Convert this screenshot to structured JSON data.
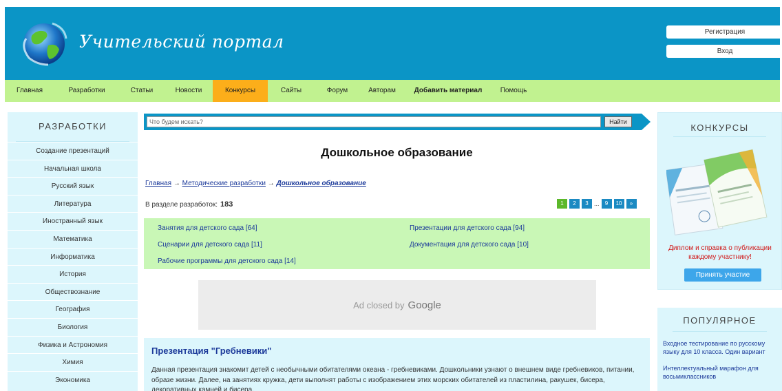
{
  "header": {
    "logo_text": "Учительский портал",
    "register": "Регистрация",
    "login": "Вход"
  },
  "nav": {
    "items": [
      {
        "label": "Главная",
        "w": 72
      },
      {
        "label": "Разработки",
        "w": 94
      },
      {
        "label": "Статьи",
        "w": 66
      },
      {
        "label": "Новости",
        "w": 70
      },
      {
        "label": "Конкурсы",
        "w": 80,
        "active": true
      },
      {
        "label": "Сайты",
        "w": 68
      },
      {
        "label": "Форум",
        "w": 66
      },
      {
        "label": "Авторам",
        "w": 64
      },
      {
        "label": "Добавить материал",
        "w": 128,
        "bold": true
      },
      {
        "label": "Помощь",
        "w": 62
      }
    ]
  },
  "left_panel": {
    "title": "РАЗРАБОТКИ",
    "items": [
      "Создание презентаций",
      "Начальная школа",
      "Русский язык",
      "Литература",
      "Иностранный язык",
      "Математика",
      "Информатика",
      "История",
      "Обществознание",
      "География",
      "Биология",
      "Физика и Астрономия",
      "Химия",
      "Экономика"
    ]
  },
  "search": {
    "placeholder": "Что будем искать?",
    "button": "Найти"
  },
  "main": {
    "title": "Дошкольное образование",
    "breadcrumb": {
      "home": "Главная",
      "sep": " → ",
      "section": "Методические разработки",
      "current": "Дошкольное образование"
    },
    "count_label": "В разделе разработок:",
    "count_value": "183",
    "pager": {
      "pages": [
        "1",
        "2",
        "3"
      ],
      "dots": "...",
      "last_pages": [
        "9",
        "10"
      ],
      "next": "»"
    },
    "categories": [
      "Занятия для детского сада [64]",
      "Презентации для детского сада [94]",
      "Сценарии для детского сада [11]",
      "Документация для детского сада [10]",
      "Рабочие программы для детского сада [14]"
    ],
    "ad": {
      "text": "Ad closed by",
      "brand": "Google"
    },
    "article": {
      "title": "Презентация \"Гребневики\"",
      "text": "Данная презентация знакомит детей с необычными обитателями океана - гребневиками. Дошкольники узнают о внешнем виде гребневиков, питании, образе жизни. Далее, на занятиях кружка, дети выполнят работы с изображением этих морских обитателей из пластилина, ракушек, бисера, декоративных камней и бисера."
    }
  },
  "right_contests": {
    "title": "КОНКУРСЫ",
    "text": "Диплом и справка о публикации каждому участнику!",
    "button": "Принять участие"
  },
  "right_popular": {
    "title": "ПОПУЛЯРНОЕ",
    "items": [
      "Входное тестирование по русскому языку для 10 класса. Один вариант",
      "Интеллектуальный марафон для восьмиклассников"
    ]
  },
  "colors": {
    "header_blue": "#0b95c6",
    "nav_green": "#c1f290",
    "nav_active": "#fcae1a",
    "panel_bg": "#dcf6fc",
    "link": "#1c3a9a",
    "accent_red": "#d11a1a"
  }
}
